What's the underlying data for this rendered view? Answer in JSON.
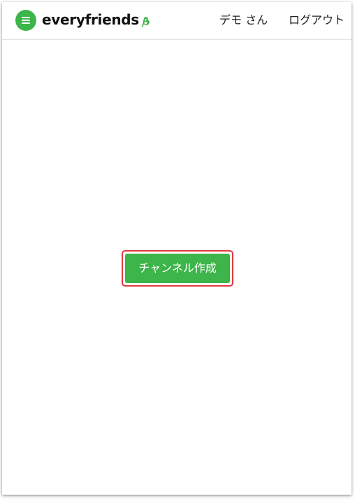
{
  "header": {
    "logo_text": "everyfriends",
    "user_name": "デモ さん",
    "logout_label": "ログアウト"
  },
  "main": {
    "create_channel_label": "チャンネル作成"
  },
  "colors": {
    "brand_green": "#3db54a",
    "highlight_red": "#e03a3e"
  },
  "icons": {
    "menu": "hamburger-icon",
    "logo_mark": "beta-leaf-icon"
  }
}
